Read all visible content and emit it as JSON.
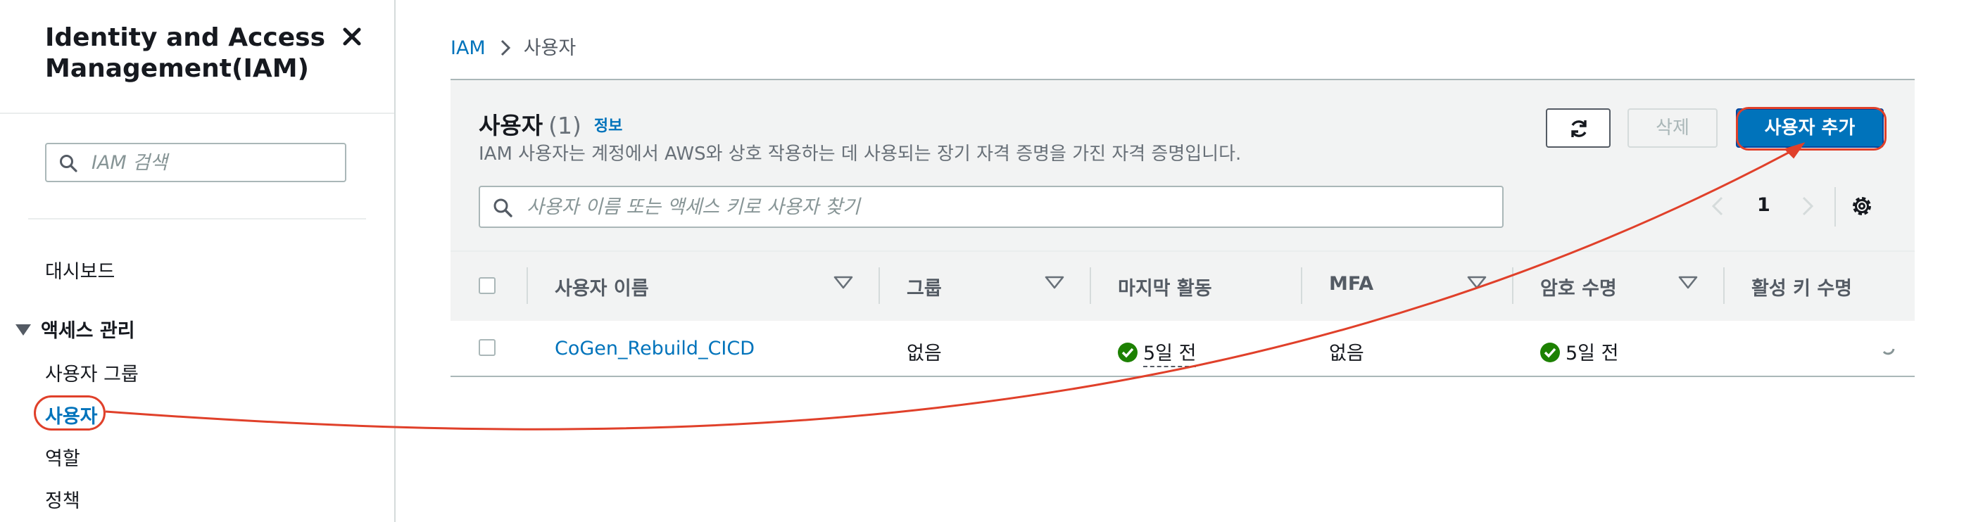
{
  "sidebar": {
    "title": "Identity and Access Management(IAM)",
    "search_placeholder": "IAM 검색",
    "items": {
      "dashboard": "대시보드",
      "access_management": "액세스 관리",
      "user_groups": "사용자 그룹",
      "users": "사용자",
      "roles": "역할",
      "policies": "정책"
    }
  },
  "breadcrumb": {
    "root": "IAM",
    "current": "사용자"
  },
  "panel": {
    "title": "사용자",
    "count": "(1)",
    "info": "정보",
    "description": "IAM 사용자는 계정에서 AWS와 상호 작용하는 데 사용되는 장기 자격 증명을 가진 자격 증명입니다.",
    "delete_label": "삭제",
    "add_user_label": "사용자 추가",
    "search_placeholder": "사용자 이름 또는 액세스 키로 사용자 찾기",
    "page": "1"
  },
  "table": {
    "columns": [
      "사용자 이름",
      "그룹",
      "마지막 활동",
      "MFA",
      "암호 수명",
      "활성 키 수명"
    ],
    "rows": [
      {
        "username": "CoGen_Rebuild_CICD",
        "groups": "없음",
        "last_activity": "5일 전",
        "mfa": "없음",
        "password_age": "5일 전",
        "active_key_age": ""
      }
    ]
  },
  "colors": {
    "link": "#0073bb",
    "primary_button": "#0073bb",
    "annotation": "#e0402a",
    "success": "#1d8102"
  },
  "icons": [
    "close-icon",
    "search-icon",
    "refresh-icon",
    "chevron-left-icon",
    "chevron-right-icon",
    "settings-icon",
    "sort-icon",
    "check-circle-icon",
    "loading-icon"
  ]
}
